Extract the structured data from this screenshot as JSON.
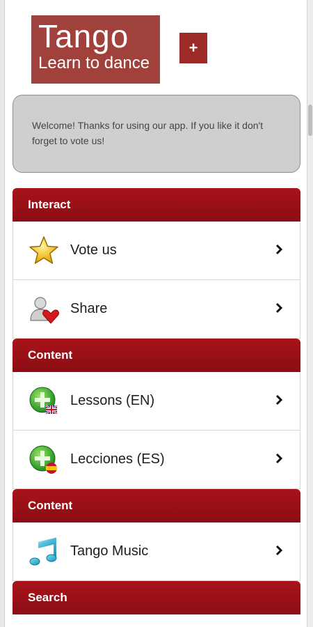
{
  "header": {
    "logo_title": "Tango",
    "logo_subtitle": "Learn to dance",
    "add_button_label": "+"
  },
  "welcome": {
    "message": "Welcome! Thanks for using our app. If you like it don't forget to vote us!"
  },
  "sections": [
    {
      "title": "Interact",
      "items": [
        {
          "label": "Vote us",
          "icon": "star-icon"
        },
        {
          "label": "Share",
          "icon": "share-user-heart-icon"
        }
      ]
    },
    {
      "title": "Content",
      "items": [
        {
          "label": "Lessons (EN)",
          "icon": "lesson-en-icon"
        },
        {
          "label": "Lecciones (ES)",
          "icon": "lesson-es-icon"
        }
      ]
    },
    {
      "title": "Content",
      "items": [
        {
          "label": "Tango Music",
          "icon": "music-note-icon"
        }
      ]
    },
    {
      "title": "Search",
      "items": []
    }
  ],
  "colors": {
    "brand": "#a0413b",
    "header_red": "#9a1016",
    "welcome_bg": "#cfcfcf"
  }
}
